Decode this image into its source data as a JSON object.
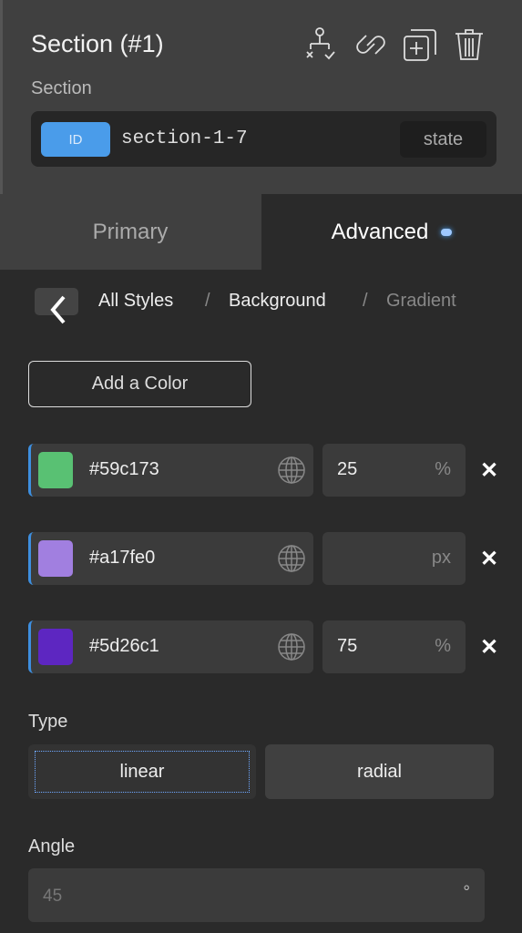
{
  "header": {
    "title": "Section (#1)",
    "subtitle": "Section",
    "id_badge": "ID",
    "id_value": "section-1-7",
    "state_label": "state",
    "icons": [
      "structure-icon",
      "link-icon",
      "duplicate-icon",
      "trash-icon"
    ]
  },
  "tabs": [
    {
      "label": "Primary",
      "active": false
    },
    {
      "label": "Advanced",
      "active": true
    }
  ],
  "breadcrumb": [
    "All Styles",
    "Background",
    "Gradient"
  ],
  "add_color_label": "Add a Color",
  "colors": [
    {
      "hex": "#59c173",
      "value": "25",
      "unit": "%"
    },
    {
      "hex": "#a17fe0",
      "value": "",
      "unit": "px"
    },
    {
      "hex": "#5d26c1",
      "value": "75",
      "unit": "%"
    }
  ],
  "type": {
    "label": "Type",
    "options": [
      "linear",
      "radial"
    ],
    "selected": "linear"
  },
  "angle": {
    "label": "Angle",
    "placeholder": "45",
    "unit": "°"
  },
  "accent": "#4a9cea"
}
